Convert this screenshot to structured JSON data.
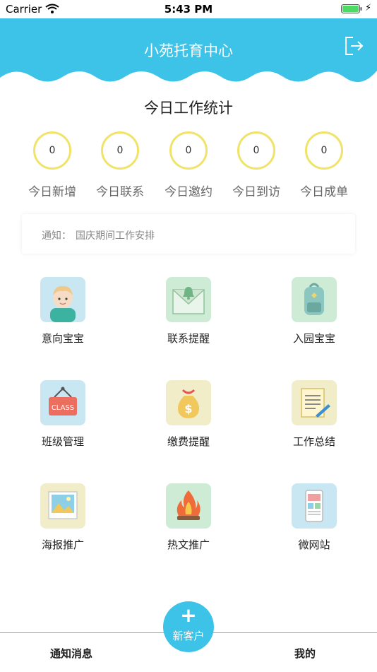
{
  "status_bar": {
    "carrier": "Carrier",
    "time": "5:43 PM"
  },
  "header": {
    "title": "小苑托育中心",
    "bg_color": "#3dc3e8"
  },
  "stats": {
    "title": "今日工作统计",
    "items": [
      {
        "value": "0",
        "label": "今日新增"
      },
      {
        "value": "0",
        "label": "今日联系"
      },
      {
        "value": "0",
        "label": "今日邀约"
      },
      {
        "value": "0",
        "label": "今日到访"
      },
      {
        "value": "0",
        "label": "今日成单"
      }
    ]
  },
  "notice": {
    "prefix": "通知：",
    "text": "国庆期间工作安排"
  },
  "grid": [
    {
      "label": "意向宝宝",
      "icon": "baby-face-icon"
    },
    {
      "label": "联系提醒",
      "icon": "mail-bell-icon"
    },
    {
      "label": "入园宝宝",
      "icon": "backpack-icon"
    },
    {
      "label": "班级管理",
      "icon": "class-sign-icon"
    },
    {
      "label": "缴费提醒",
      "icon": "money-bag-icon"
    },
    {
      "label": "工作总结",
      "icon": "document-pen-icon"
    },
    {
      "label": "海报推广",
      "icon": "poster-image-icon"
    },
    {
      "label": "热文推广",
      "icon": "fire-icon"
    },
    {
      "label": "微网站",
      "icon": "mobile-site-icon"
    }
  ],
  "tabbar": {
    "left": "通知消息",
    "center_plus": "+",
    "center_label": "新客户",
    "right": "我的"
  }
}
